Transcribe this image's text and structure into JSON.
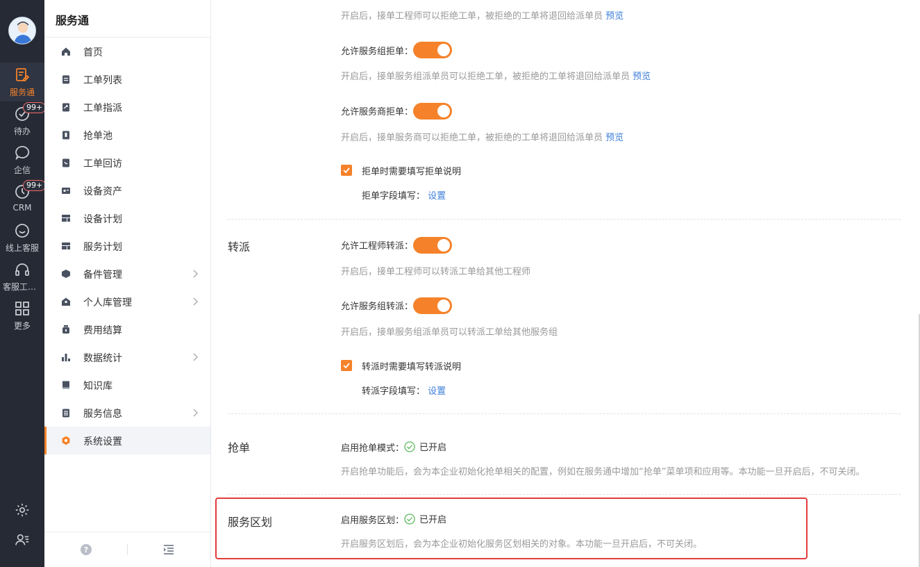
{
  "rail": {
    "items": [
      {
        "label": "服务通",
        "icon": "service-icon",
        "active": true
      },
      {
        "label": "待办",
        "icon": "todo-icon",
        "badge": "99+"
      },
      {
        "label": "企信",
        "icon": "chat-icon"
      },
      {
        "label": "CRM",
        "icon": "crm-icon",
        "badge": "99+"
      },
      {
        "label": "线上客服",
        "icon": "online-service-icon"
      },
      {
        "label": "客服工作台",
        "icon": "headset-icon"
      },
      {
        "label": "更多",
        "icon": "grid-icon"
      }
    ],
    "bottom": [
      "gear-icon",
      "user-list-icon"
    ]
  },
  "sidebar": {
    "title": "服务通",
    "items": [
      {
        "label": "首页",
        "icon": "home-icon"
      },
      {
        "label": "工单列表",
        "icon": "clipboard-icon"
      },
      {
        "label": "工单指派",
        "icon": "assign-icon"
      },
      {
        "label": "抢单池",
        "icon": "pool-icon"
      },
      {
        "label": "工单回访",
        "icon": "revisit-icon"
      },
      {
        "label": "设备资产",
        "icon": "asset-icon"
      },
      {
        "label": "设备计划",
        "icon": "device-plan-icon"
      },
      {
        "label": "服务计划",
        "icon": "service-plan-icon"
      },
      {
        "label": "备件管理",
        "icon": "parts-icon",
        "has_children": true
      },
      {
        "label": "个人库管理",
        "icon": "warehouse-icon",
        "has_children": true
      },
      {
        "label": "费用结算",
        "icon": "money-bag-icon"
      },
      {
        "label": "数据统计",
        "icon": "bar-chart-icon",
        "has_children": true
      },
      {
        "label": "知识库",
        "icon": "book-icon"
      },
      {
        "label": "服务信息",
        "icon": "info-list-icon",
        "has_children": true
      },
      {
        "label": "系统设置",
        "icon": "settings-icon",
        "active": true
      }
    ],
    "footer": [
      "help-icon",
      "collapse-menu-icon"
    ]
  },
  "main": {
    "top_desc": "开启后，接单工程师可以拒绝工单，被拒绝的工单将退回给派单员",
    "reject": {
      "group_label": "允许服务组拒单：",
      "group_desc": "开启后，接单服务组派单员可以拒绝工单，被拒绝的工单将退回给派单员",
      "provider_label": "允许服务商拒单：",
      "provider_desc": "开启后，接单服务商可以拒绝工单，被拒绝的工单将退回给派单员",
      "checkbox_label": "拒单时需要填写拒单说明",
      "field_label": "拒单字段填写："
    },
    "transfer": {
      "title": "转派",
      "engineer_label": "允许工程师转派：",
      "engineer_desc": "开启后，接单工程师可以转派工单给其他工程师",
      "group_label": "允许服务组转派：",
      "group_desc": "开启后，接单服务组派单员可以转派工单给其他服务组",
      "checkbox_label": "转派时需要填写转派说明",
      "field_label": "转派字段填写："
    },
    "grab": {
      "title": "抢单",
      "label": "启用抢单模式：",
      "status": "已开启",
      "desc": "开启抢单功能后，会为本企业初始化抢单相关的配置，例如在服务通中增加“抢单”菜单项和应用等。本功能一旦开启后，不可关闭。"
    },
    "zone": {
      "title": "服务区划",
      "label": "启用服务区划：",
      "status": "已开启",
      "desc": "开启服务区划后，会为本企业初始化服务区划相关的对象。本功能一旦开启后，不可关闭。"
    },
    "preview_label": "预览",
    "set_label": "设置"
  },
  "colors": {
    "accent": "#f5822a",
    "link": "#3d7fd9",
    "rail_bg": "#252a34",
    "highlight": "#e23b3b",
    "success": "#5cb85c"
  }
}
